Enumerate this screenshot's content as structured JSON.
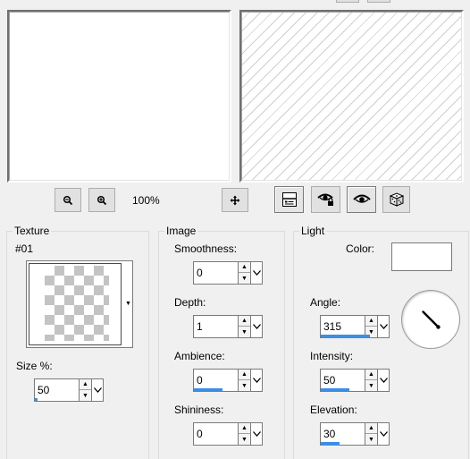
{
  "window": {
    "zoom_level": "100%"
  },
  "toolbar": {
    "zoom_out": "zoom-out-icon",
    "zoom_in": "zoom-in-icon",
    "pan": "move-icon",
    "layout": "layout-icon",
    "proof": "eye-lock-icon",
    "auto_proof": "eye-icon",
    "randomize": "dice-icon"
  },
  "texture": {
    "legend": "Texture",
    "name": "#01",
    "size_label": "Size %:",
    "size_value": "50",
    "size_fraction": 0.05
  },
  "image": {
    "legend": "Image",
    "smoothness_label": "Smoothness:",
    "smoothness_value": "0",
    "smoothness_fraction": 0.0,
    "depth_label": "Depth:",
    "depth_value": "1",
    "depth_fraction": 0.0,
    "ambience_label": "Ambience:",
    "ambience_value": "0",
    "ambience_fraction": 0.5,
    "shininess_label": "Shininess:",
    "shininess_value": "0",
    "shininess_fraction": 0.0
  },
  "light": {
    "legend": "Light",
    "color_label": "Color:",
    "color_value": "#ffffff",
    "angle_label": "Angle:",
    "angle_value": "315",
    "angle_fraction": 0.875,
    "intensity_label": "Intensity:",
    "intensity_value": "50",
    "intensity_fraction": 0.5,
    "elevation_label": "Elevation:",
    "elevation_value": "30",
    "elevation_fraction": 0.33
  },
  "colors": {
    "accent": "#3a8ee6",
    "panel": "#f0f0f0"
  }
}
